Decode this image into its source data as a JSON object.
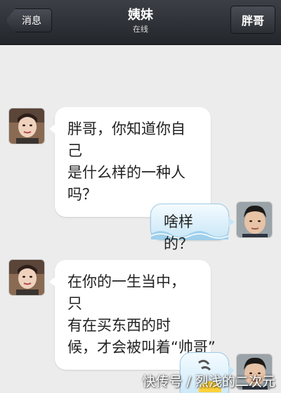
{
  "header": {
    "back_label": "消息",
    "title": "姨妹",
    "status": "在线",
    "right_label": "胖哥"
  },
  "messages": [
    {
      "side": "left",
      "lines": [
        "胖哥，你知道你自己",
        "是什么样的一种人",
        "吗？"
      ]
    },
    {
      "side": "right",
      "text": "啥样的？"
    },
    {
      "side": "left",
      "lines": [
        "在你的一生当中，只",
        "有在买东西的时",
        "候，才会被叫着“帅哥”"
      ]
    },
    {
      "side": "right",
      "text": ""
    }
  ],
  "watermark": "快传号 / 烈浅的二次元",
  "colors": {
    "header": "#2b2e33",
    "background": "#ececec",
    "bubble_left": "#ffffff",
    "bubble_right": "#c8e6f7"
  }
}
